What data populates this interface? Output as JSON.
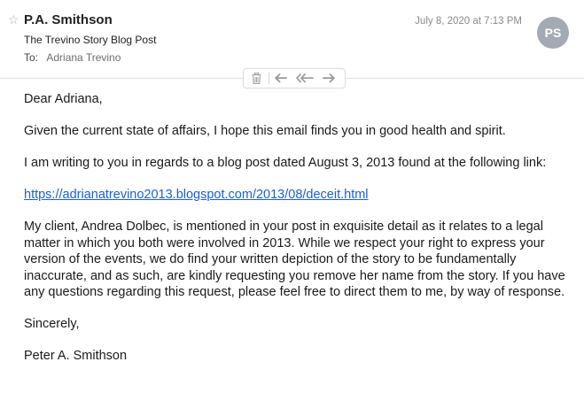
{
  "header": {
    "sender": "P.A. Smithson",
    "subject": "The Trevino Story Blog Post",
    "to_label": "To:",
    "to_name": "Adriana Trevino",
    "date": "July 8, 2020 at 7:13 PM",
    "avatar_initials": "PS"
  },
  "toolbar": {
    "icons": [
      "trash-icon",
      "reply-icon",
      "reply-all-icon",
      "forward-icon"
    ]
  },
  "body": {
    "greeting": "Dear Adriana,",
    "para1": "Given the current state of affairs, I hope this email finds you in good health and spirit.",
    "para2": "I am writing to you in regards to a blog post dated August 3, 2013 found at the following link:",
    "link": "https://adrianatrevino2013.blogspot.com/2013/08/deceit.html",
    "para3": "My client, Andrea Dolbec, is mentioned in your post in exquisite detail as it relates to a legal matter in which you both were involved in 2013.  While we respect your right to express your version of the events, we do find your written depiction of the story to be fundamentally inaccurate, and as such, are kindly requesting you remove her name from the story.  If you have any questions regarding this request, please feel free to direct them to me, by way of response.",
    "closing": "Sincerely,",
    "signature": "Peter A. Smithson"
  }
}
